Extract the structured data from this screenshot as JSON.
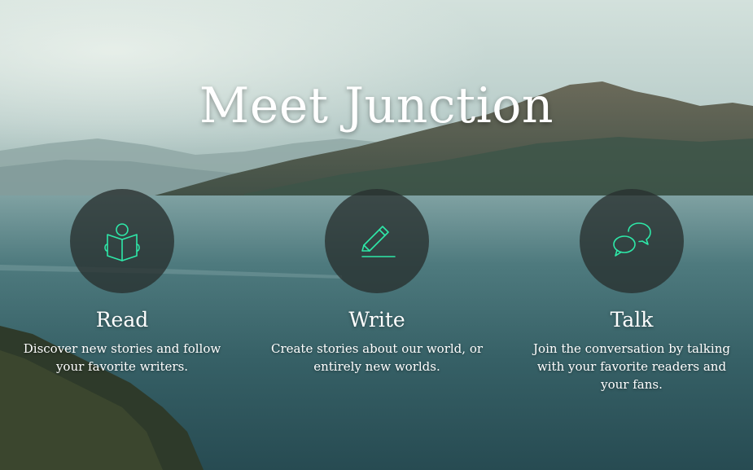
{
  "hero": {
    "title": "Meet Junction"
  },
  "features": [
    {
      "icon": "open-book-icon",
      "title": "Read",
      "description": "Discover new stories and follow your favorite writers."
    },
    {
      "icon": "pencil-icon",
      "title": "Write",
      "description": "Create stories about our world, or entirely new worlds."
    },
    {
      "icon": "chat-bubbles-icon",
      "title": "Talk",
      "description": "Join the conversation by talking with your favorite readers and your fans."
    }
  ],
  "colors": {
    "icon_accent": "#2ee8a8",
    "circle_bg": "#28302e",
    "text": "#ffffff"
  }
}
